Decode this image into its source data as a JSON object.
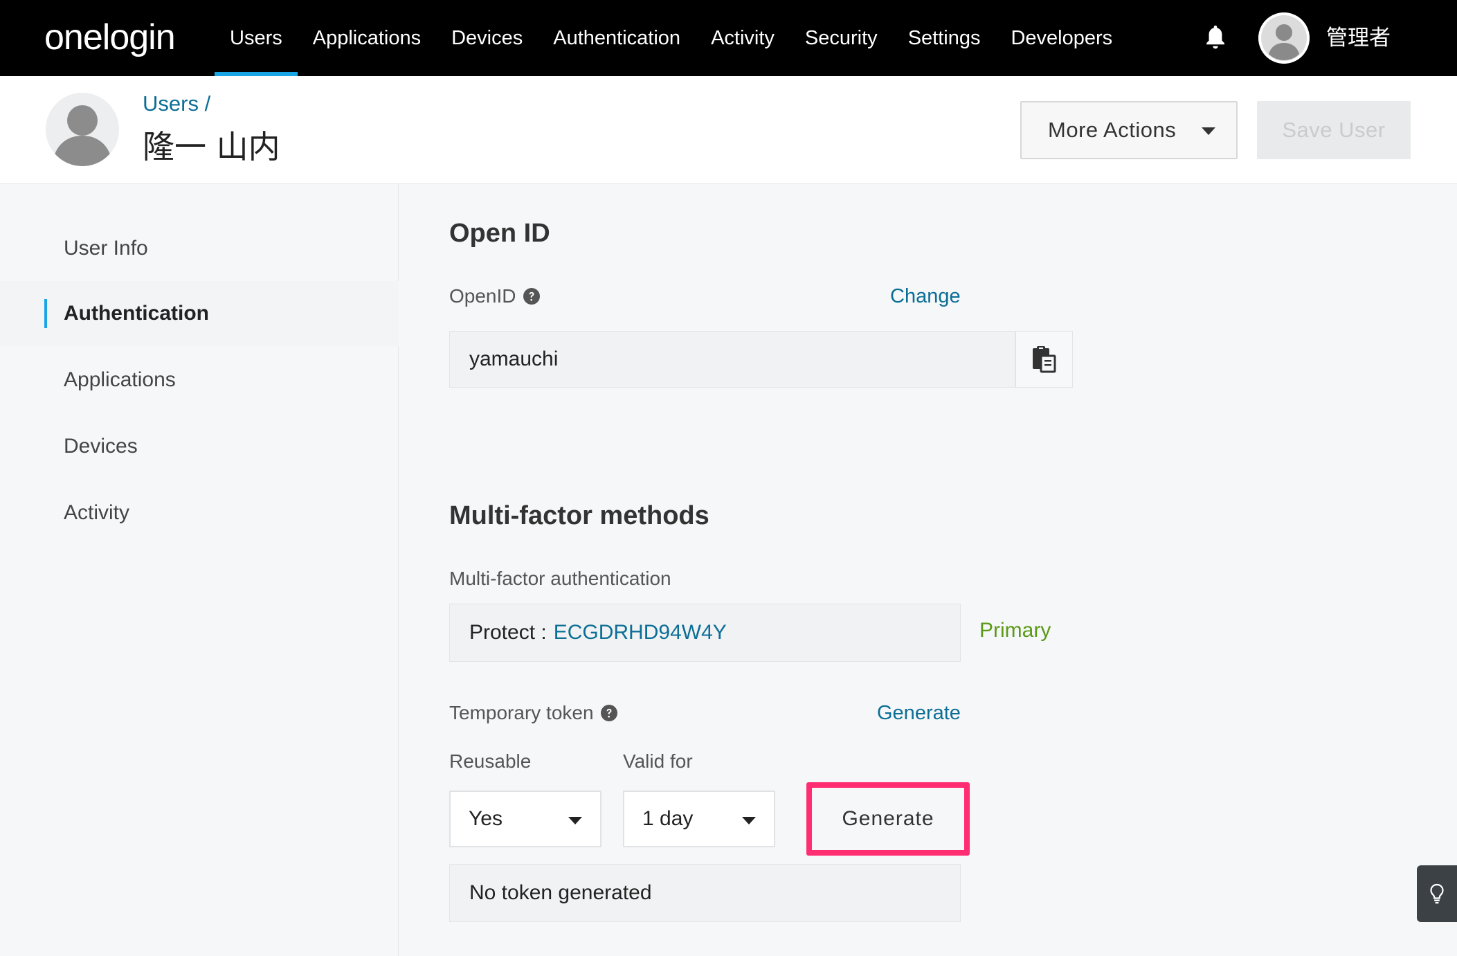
{
  "brand": {
    "logo_text": "onelogin",
    "accent": "#1aa6e4",
    "link": "#0c6e96",
    "highlight": "#ff2e73"
  },
  "topnav": {
    "items": [
      "Users",
      "Applications",
      "Devices",
      "Authentication",
      "Activity",
      "Security",
      "Settings",
      "Developers"
    ],
    "active": "Users",
    "notification_icon": "bell-icon",
    "admin_name": "管理者"
  },
  "header": {
    "breadcrumb": "Users /",
    "user_name": "隆一 山内",
    "more_actions_label": "More Actions",
    "save_user_label": "Save User"
  },
  "sidebar": {
    "items": [
      "User Info",
      "Authentication",
      "Applications",
      "Devices",
      "Activity"
    ],
    "active": "Authentication"
  },
  "main": {
    "openid": {
      "section_title": "Open ID",
      "label": "OpenID",
      "change_link": "Change",
      "value": "yamauchi",
      "copy_icon": "clipboard-icon"
    },
    "mfa": {
      "section_title": "Multi-factor methods",
      "label": "Multi-factor authentication",
      "method_name": "Protect :",
      "method_id": "ECGDRHD94W4Y",
      "primary_label": "Primary"
    },
    "temp_token": {
      "label": "Temporary token",
      "generate_link": "Generate",
      "reusable_label": "Reusable",
      "reusable_value": "Yes",
      "valid_for_label": "Valid for",
      "valid_for_value": "1 day",
      "generate_button": "Generate",
      "status": "No token generated"
    }
  },
  "tip_icon": "lightbulb-icon"
}
